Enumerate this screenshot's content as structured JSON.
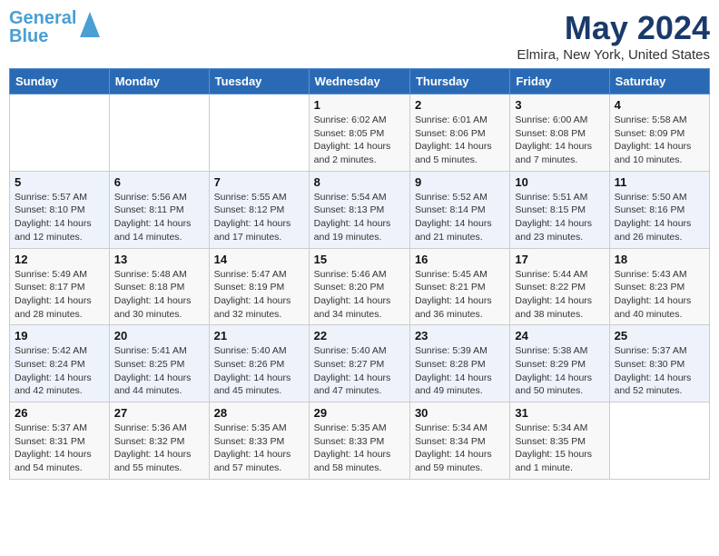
{
  "logo": {
    "text1": "General",
    "text2": "Blue"
  },
  "title": "May 2024",
  "location": "Elmira, New York, United States",
  "weekdays": [
    "Sunday",
    "Monday",
    "Tuesday",
    "Wednesday",
    "Thursday",
    "Friday",
    "Saturday"
  ],
  "weeks": [
    [
      {
        "day": "",
        "info": ""
      },
      {
        "day": "",
        "info": ""
      },
      {
        "day": "",
        "info": ""
      },
      {
        "day": "1",
        "info": "Sunrise: 6:02 AM\nSunset: 8:05 PM\nDaylight: 14 hours\nand 2 minutes."
      },
      {
        "day": "2",
        "info": "Sunrise: 6:01 AM\nSunset: 8:06 PM\nDaylight: 14 hours\nand 5 minutes."
      },
      {
        "day": "3",
        "info": "Sunrise: 6:00 AM\nSunset: 8:08 PM\nDaylight: 14 hours\nand 7 minutes."
      },
      {
        "day": "4",
        "info": "Sunrise: 5:58 AM\nSunset: 8:09 PM\nDaylight: 14 hours\nand 10 minutes."
      }
    ],
    [
      {
        "day": "5",
        "info": "Sunrise: 5:57 AM\nSunset: 8:10 PM\nDaylight: 14 hours\nand 12 minutes."
      },
      {
        "day": "6",
        "info": "Sunrise: 5:56 AM\nSunset: 8:11 PM\nDaylight: 14 hours\nand 14 minutes."
      },
      {
        "day": "7",
        "info": "Sunrise: 5:55 AM\nSunset: 8:12 PM\nDaylight: 14 hours\nand 17 minutes."
      },
      {
        "day": "8",
        "info": "Sunrise: 5:54 AM\nSunset: 8:13 PM\nDaylight: 14 hours\nand 19 minutes."
      },
      {
        "day": "9",
        "info": "Sunrise: 5:52 AM\nSunset: 8:14 PM\nDaylight: 14 hours\nand 21 minutes."
      },
      {
        "day": "10",
        "info": "Sunrise: 5:51 AM\nSunset: 8:15 PM\nDaylight: 14 hours\nand 23 minutes."
      },
      {
        "day": "11",
        "info": "Sunrise: 5:50 AM\nSunset: 8:16 PM\nDaylight: 14 hours\nand 26 minutes."
      }
    ],
    [
      {
        "day": "12",
        "info": "Sunrise: 5:49 AM\nSunset: 8:17 PM\nDaylight: 14 hours\nand 28 minutes."
      },
      {
        "day": "13",
        "info": "Sunrise: 5:48 AM\nSunset: 8:18 PM\nDaylight: 14 hours\nand 30 minutes."
      },
      {
        "day": "14",
        "info": "Sunrise: 5:47 AM\nSunset: 8:19 PM\nDaylight: 14 hours\nand 32 minutes."
      },
      {
        "day": "15",
        "info": "Sunrise: 5:46 AM\nSunset: 8:20 PM\nDaylight: 14 hours\nand 34 minutes."
      },
      {
        "day": "16",
        "info": "Sunrise: 5:45 AM\nSunset: 8:21 PM\nDaylight: 14 hours\nand 36 minutes."
      },
      {
        "day": "17",
        "info": "Sunrise: 5:44 AM\nSunset: 8:22 PM\nDaylight: 14 hours\nand 38 minutes."
      },
      {
        "day": "18",
        "info": "Sunrise: 5:43 AM\nSunset: 8:23 PM\nDaylight: 14 hours\nand 40 minutes."
      }
    ],
    [
      {
        "day": "19",
        "info": "Sunrise: 5:42 AM\nSunset: 8:24 PM\nDaylight: 14 hours\nand 42 minutes."
      },
      {
        "day": "20",
        "info": "Sunrise: 5:41 AM\nSunset: 8:25 PM\nDaylight: 14 hours\nand 44 minutes."
      },
      {
        "day": "21",
        "info": "Sunrise: 5:40 AM\nSunset: 8:26 PM\nDaylight: 14 hours\nand 45 minutes."
      },
      {
        "day": "22",
        "info": "Sunrise: 5:40 AM\nSunset: 8:27 PM\nDaylight: 14 hours\nand 47 minutes."
      },
      {
        "day": "23",
        "info": "Sunrise: 5:39 AM\nSunset: 8:28 PM\nDaylight: 14 hours\nand 49 minutes."
      },
      {
        "day": "24",
        "info": "Sunrise: 5:38 AM\nSunset: 8:29 PM\nDaylight: 14 hours\nand 50 minutes."
      },
      {
        "day": "25",
        "info": "Sunrise: 5:37 AM\nSunset: 8:30 PM\nDaylight: 14 hours\nand 52 minutes."
      }
    ],
    [
      {
        "day": "26",
        "info": "Sunrise: 5:37 AM\nSunset: 8:31 PM\nDaylight: 14 hours\nand 54 minutes."
      },
      {
        "day": "27",
        "info": "Sunrise: 5:36 AM\nSunset: 8:32 PM\nDaylight: 14 hours\nand 55 minutes."
      },
      {
        "day": "28",
        "info": "Sunrise: 5:35 AM\nSunset: 8:33 PM\nDaylight: 14 hours\nand 57 minutes."
      },
      {
        "day": "29",
        "info": "Sunrise: 5:35 AM\nSunset: 8:33 PM\nDaylight: 14 hours\nand 58 minutes."
      },
      {
        "day": "30",
        "info": "Sunrise: 5:34 AM\nSunset: 8:34 PM\nDaylight: 14 hours\nand 59 minutes."
      },
      {
        "day": "31",
        "info": "Sunrise: 5:34 AM\nSunset: 8:35 PM\nDaylight: 15 hours\nand 1 minute."
      },
      {
        "day": "",
        "info": ""
      }
    ]
  ]
}
